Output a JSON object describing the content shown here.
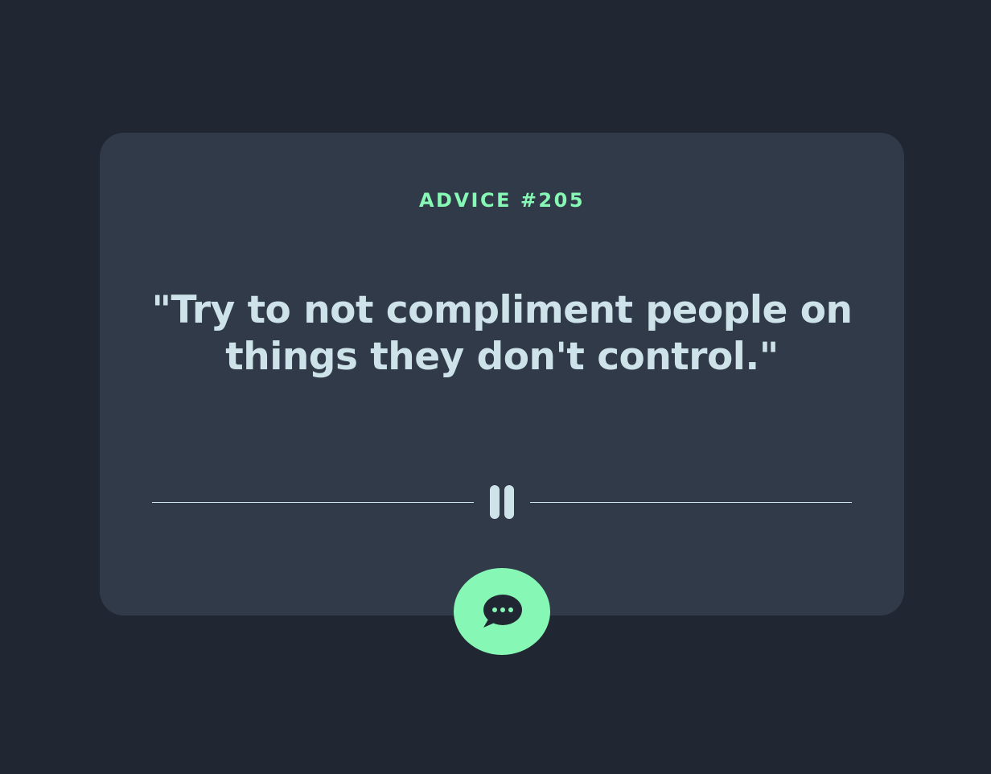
{
  "card": {
    "advice_label": "ADVICE #205",
    "quote": "\"Try to not compliment people on things they don't control.\""
  },
  "divider": {
    "icon": "pause-icon"
  },
  "action_button": {
    "icon": "chat-bubble-icon"
  },
  "colors": {
    "background": "#202632",
    "card": "#313A48",
    "accent": "#86F7B4",
    "text": "#CEE3E9"
  }
}
